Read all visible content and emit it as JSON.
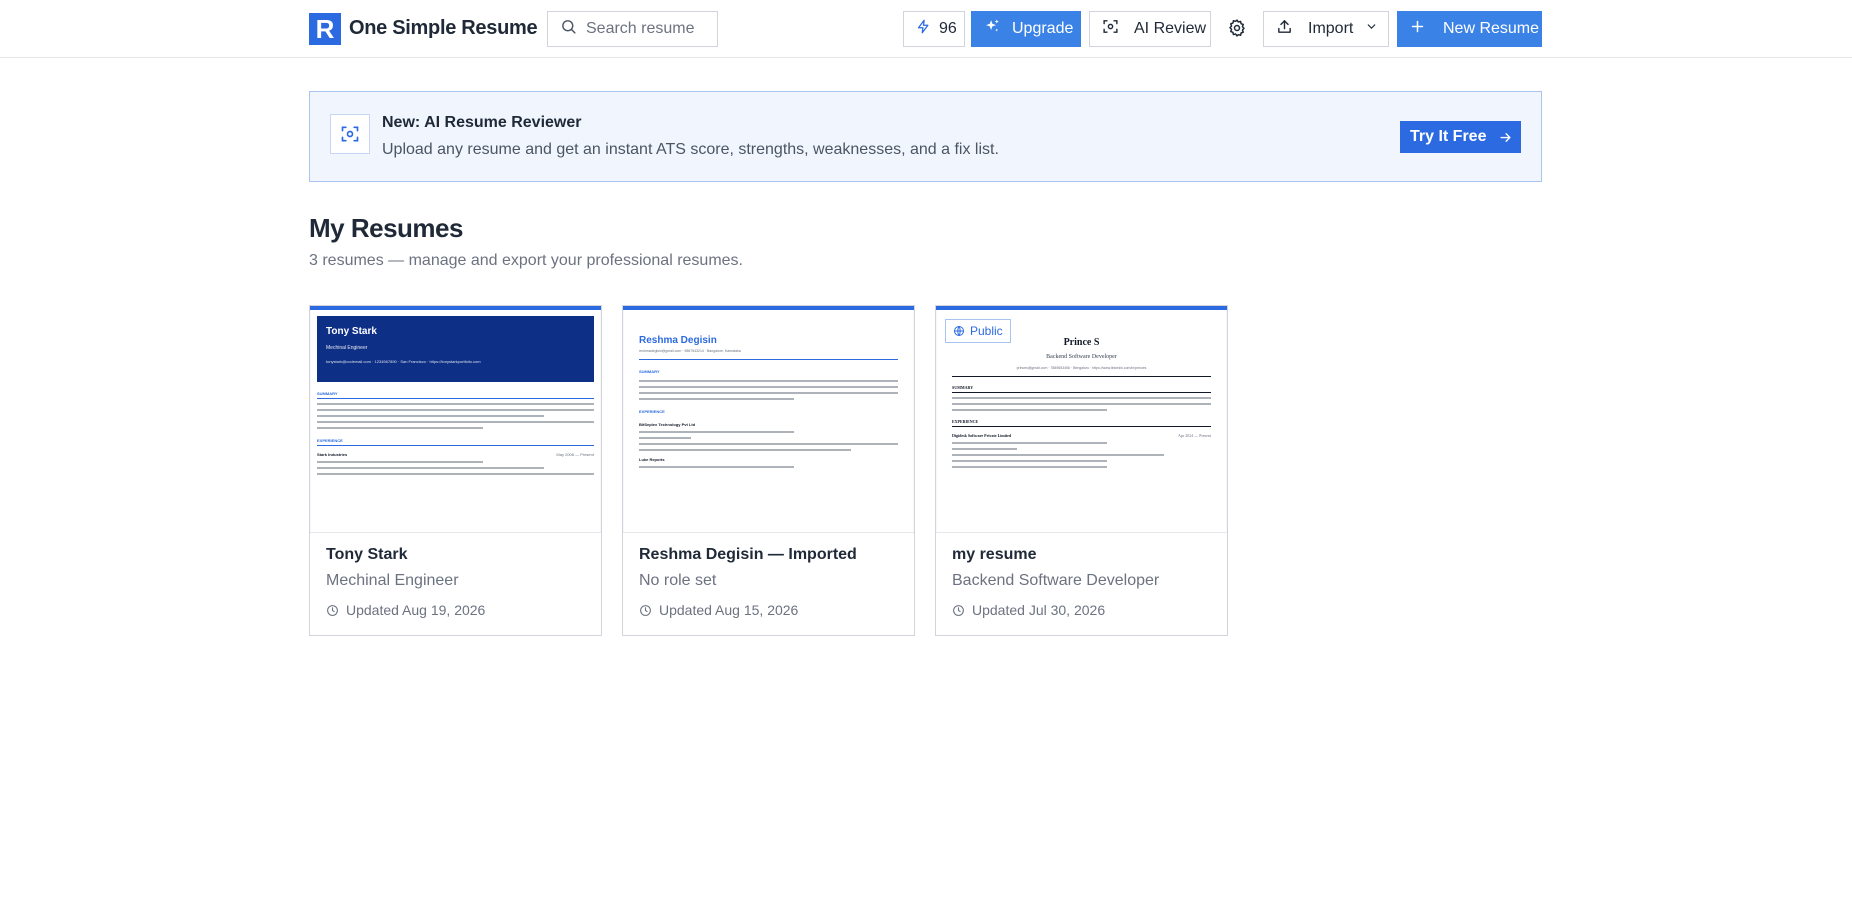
{
  "header": {
    "logo_letter": "R",
    "brand": "One Simple Resume",
    "search_placeholder": "Search resume",
    "credits": "96",
    "upgrade_label": "Upgrade",
    "ai_review_label": "AI Review",
    "import_label": "Import",
    "new_resume_label": "New Resume"
  },
  "banner": {
    "title": "New: AI Resume Reviewer",
    "description": "Upload any resume and get an instant ATS score, strengths, weaknesses, and a fix list.",
    "cta_label": "Try It Free"
  },
  "main": {
    "title": "My Resumes",
    "subtitle": "3 resumes — manage and export your professional resumes."
  },
  "resumes": [
    {
      "title": "Tony Stark",
      "role": "Mechinal Engineer",
      "updated": "Updated Aug 19, 2026",
      "preview": {
        "name": "Tony Stark",
        "role": "Mechinal Engineer",
        "contact": "tonystark@codemail.com   ·   1234567890   ·   San Francisco   ·   https://tonystarkportfolio.com",
        "summary_heading": "SUMMARY",
        "experience_heading": "EXPERIENCE",
        "company": "Stark Industries",
        "dates": "May 2008 — Present"
      }
    },
    {
      "title": "Reshma Degisin — Imported",
      "role": "No role set",
      "updated": "Updated Aug 15, 2026",
      "preview": {
        "name": "Reshma Degisin",
        "contact": "reshmadegisin@gmail.com   ·   9867543214   ·   Bangalore, Karnataka",
        "summary_heading": "SUMMARY",
        "experience_heading": "EXPERIENCE",
        "company": "BitSeplex Technology Pvt Ltd",
        "company2": "Luke Reports"
      }
    },
    {
      "title": "my resume",
      "role": "Backend Software Developer",
      "updated": "Updated Jul 30, 2026",
      "badge": "Public",
      "preview": {
        "name": "Prince S",
        "role": "Backend Software Developer",
        "contact": "princes@gmail.com   ·   7889653456   ·   Bengaluru   ·   https://www.linkedin.com/in/princes",
        "summary_heading": "SUMMARY",
        "experience_heading": "EXPERIENCE",
        "company": "Digidesk Software Private Limited",
        "dates": "Apr 2024 — Present"
      }
    }
  ],
  "colors": {
    "accent": "#2b6ae0",
    "primary_button": "#3b82e6",
    "banner_bg": "#f1f6fe",
    "resume_header_navy": "#0e2f86"
  }
}
